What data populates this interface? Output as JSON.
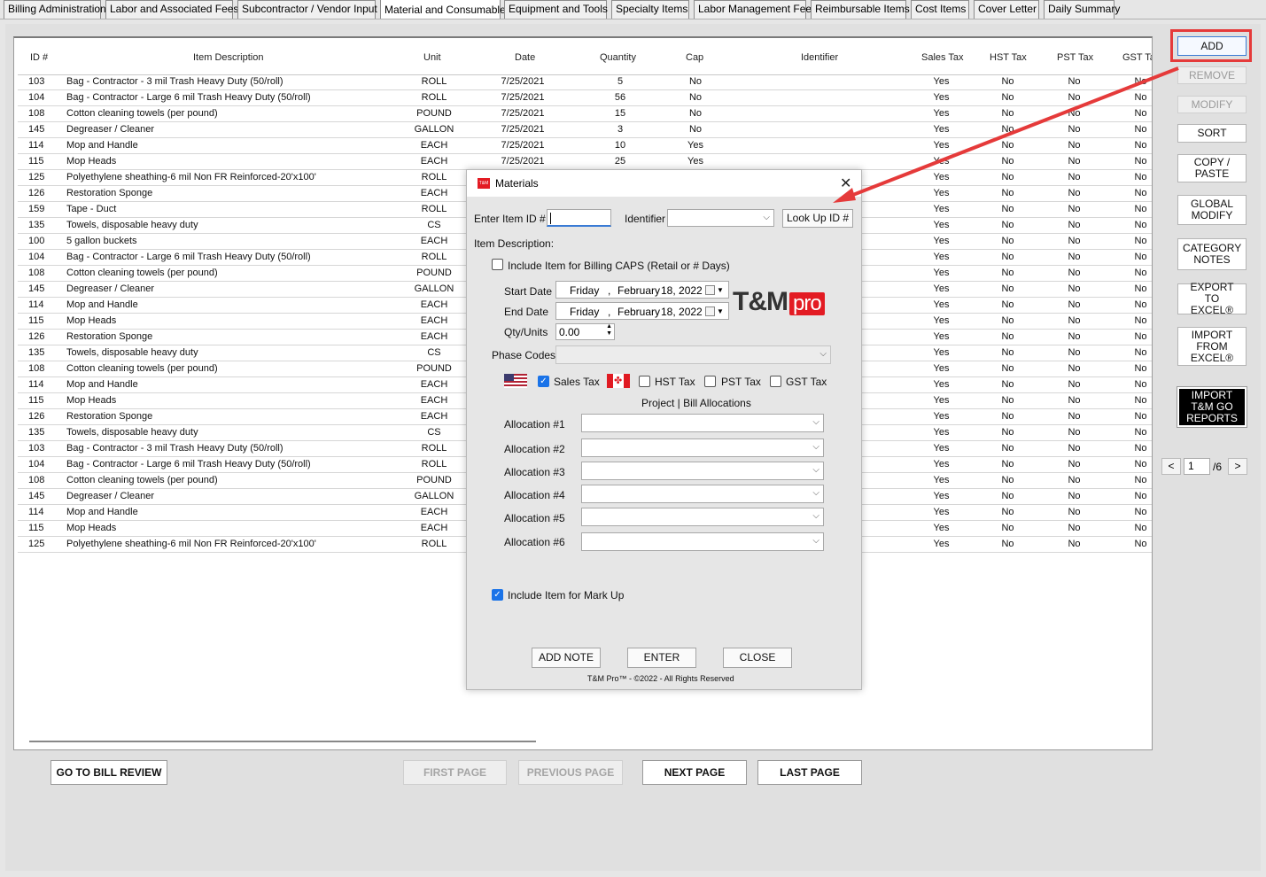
{
  "tabs": [
    "Billing Administration",
    "Labor and Associated Fees",
    "Subcontractor / Vendor Input",
    "Material and Consumable",
    "Equipment and Tools",
    "Specialty Items",
    "Labor Management Fee",
    "Reimbursable Items",
    "Cost Items",
    "Cover Letter",
    "Daily Summary"
  ],
  "active_tab": "Material and Consumable",
  "grid": {
    "headers": {
      "id": "ID #",
      "desc": "Item Description",
      "unit": "Unit",
      "date": "Date",
      "qty": "Quantity",
      "cap": "Cap",
      "identifier": "Identifier",
      "sales_tax": "Sales Tax",
      "hst": "HST Tax",
      "pst": "PST Tax",
      "gst": "GST Ta"
    },
    "rows": [
      {
        "id": "103",
        "desc": "Bag - Contractor - 3 mil Trash Heavy Duty (50/roll)",
        "unit": "ROLL",
        "date": "7/25/2021",
        "qty": "5",
        "cap": "No",
        "stx": "Yes",
        "hst": "No",
        "pst": "No",
        "gst": "No"
      },
      {
        "id": "104",
        "desc": "Bag - Contractor - Large 6 mil Trash Heavy Duty (50/roll)",
        "unit": "ROLL",
        "date": "7/25/2021",
        "qty": "56",
        "cap": "No",
        "stx": "Yes",
        "hst": "No",
        "pst": "No",
        "gst": "No"
      },
      {
        "id": "108",
        "desc": "Cotton cleaning towels (per pound)",
        "unit": "POUND",
        "date": "7/25/2021",
        "qty": "15",
        "cap": "No",
        "stx": "Yes",
        "hst": "No",
        "pst": "No",
        "gst": "No"
      },
      {
        "id": "145",
        "desc": "Degreaser / Cleaner",
        "unit": "GALLON",
        "date": "7/25/2021",
        "qty": "3",
        "cap": "No",
        "stx": "Yes",
        "hst": "No",
        "pst": "No",
        "gst": "No"
      },
      {
        "id": "114",
        "desc": "Mop and Handle",
        "unit": "EACH",
        "date": "7/25/2021",
        "qty": "10",
        "cap": "Yes",
        "stx": "Yes",
        "hst": "No",
        "pst": "No",
        "gst": "No"
      },
      {
        "id": "115",
        "desc": "Mop Heads",
        "unit": "EACH",
        "date": "7/25/2021",
        "qty": "25",
        "cap": "Yes",
        "stx": "Yes",
        "hst": "No",
        "pst": "No",
        "gst": "No"
      },
      {
        "id": "125",
        "desc": "Polyethylene sheathing-6 mil Non FR Reinforced-20'x100'",
        "unit": "ROLL",
        "date": "",
        "qty": "",
        "cap": "",
        "stx": "Yes",
        "hst": "No",
        "pst": "No",
        "gst": "No"
      },
      {
        "id": "126",
        "desc": "Restoration Sponge",
        "unit": "EACH",
        "date": "",
        "qty": "",
        "cap": "",
        "stx": "Yes",
        "hst": "No",
        "pst": "No",
        "gst": "No"
      },
      {
        "id": "159",
        "desc": "Tape - Duct",
        "unit": "ROLL",
        "date": "",
        "qty": "",
        "cap": "",
        "stx": "Yes",
        "hst": "No",
        "pst": "No",
        "gst": "No"
      },
      {
        "id": "135",
        "desc": "Towels, disposable heavy duty",
        "unit": "CS",
        "date": "",
        "qty": "",
        "cap": "",
        "stx": "Yes",
        "hst": "No",
        "pst": "No",
        "gst": "No"
      },
      {
        "id": "100",
        "desc": "5 gallon buckets",
        "unit": "EACH",
        "date": "",
        "qty": "",
        "cap": "",
        "stx": "Yes",
        "hst": "No",
        "pst": "No",
        "gst": "No"
      },
      {
        "id": "104",
        "desc": "Bag - Contractor - Large 6 mil Trash Heavy Duty (50/roll)",
        "unit": "ROLL",
        "date": "",
        "qty": "",
        "cap": "",
        "stx": "Yes",
        "hst": "No",
        "pst": "No",
        "gst": "No"
      },
      {
        "id": "108",
        "desc": "Cotton cleaning towels (per pound)",
        "unit": "POUND",
        "date": "",
        "qty": "",
        "cap": "",
        "stx": "Yes",
        "hst": "No",
        "pst": "No",
        "gst": "No"
      },
      {
        "id": "145",
        "desc": "Degreaser / Cleaner",
        "unit": "GALLON",
        "date": "",
        "qty": "",
        "cap": "",
        "stx": "Yes",
        "hst": "No",
        "pst": "No",
        "gst": "No"
      },
      {
        "id": "114",
        "desc": "Mop and Handle",
        "unit": "EACH",
        "date": "",
        "qty": "",
        "cap": "",
        "stx": "Yes",
        "hst": "No",
        "pst": "No",
        "gst": "No"
      },
      {
        "id": "115",
        "desc": "Mop Heads",
        "unit": "EACH",
        "date": "",
        "qty": "",
        "cap": "",
        "stx": "Yes",
        "hst": "No",
        "pst": "No",
        "gst": "No"
      },
      {
        "id": "126",
        "desc": "Restoration Sponge",
        "unit": "EACH",
        "date": "",
        "qty": "",
        "cap": "",
        "stx": "Yes",
        "hst": "No",
        "pst": "No",
        "gst": "No"
      },
      {
        "id": "135",
        "desc": "Towels, disposable heavy duty",
        "unit": "CS",
        "date": "",
        "qty": "",
        "cap": "",
        "stx": "Yes",
        "hst": "No",
        "pst": "No",
        "gst": "No"
      },
      {
        "id": "108",
        "desc": "Cotton cleaning towels (per pound)",
        "unit": "POUND",
        "date": "",
        "qty": "",
        "cap": "",
        "stx": "Yes",
        "hst": "No",
        "pst": "No",
        "gst": "No"
      },
      {
        "id": "114",
        "desc": "Mop and Handle",
        "unit": "EACH",
        "date": "",
        "qty": "",
        "cap": "",
        "stx": "Yes",
        "hst": "No",
        "pst": "No",
        "gst": "No"
      },
      {
        "id": "115",
        "desc": "Mop Heads",
        "unit": "EACH",
        "date": "",
        "qty": "",
        "cap": "",
        "stx": "Yes",
        "hst": "No",
        "pst": "No",
        "gst": "No"
      },
      {
        "id": "126",
        "desc": "Restoration Sponge",
        "unit": "EACH",
        "date": "",
        "qty": "",
        "cap": "",
        "stx": "Yes",
        "hst": "No",
        "pst": "No",
        "gst": "No"
      },
      {
        "id": "135",
        "desc": "Towels, disposable heavy duty",
        "unit": "CS",
        "date": "",
        "qty": "",
        "cap": "",
        "stx": "Yes",
        "hst": "No",
        "pst": "No",
        "gst": "No"
      },
      {
        "id": "103",
        "desc": "Bag - Contractor - 3 mil Trash Heavy Duty (50/roll)",
        "unit": "ROLL",
        "date": "",
        "qty": "",
        "cap": "",
        "stx": "Yes",
        "hst": "No",
        "pst": "No",
        "gst": "No"
      },
      {
        "id": "104",
        "desc": "Bag - Contractor - Large 6 mil Trash Heavy Duty (50/roll)",
        "unit": "ROLL",
        "date": "",
        "qty": "",
        "cap": "",
        "stx": "Yes",
        "hst": "No",
        "pst": "No",
        "gst": "No"
      },
      {
        "id": "108",
        "desc": "Cotton cleaning towels (per pound)",
        "unit": "POUND",
        "date": "",
        "qty": "",
        "cap": "",
        "stx": "Yes",
        "hst": "No",
        "pst": "No",
        "gst": "No"
      },
      {
        "id": "145",
        "desc": "Degreaser / Cleaner",
        "unit": "GALLON",
        "date": "",
        "qty": "",
        "cap": "",
        "stx": "Yes",
        "hst": "No",
        "pst": "No",
        "gst": "No"
      },
      {
        "id": "114",
        "desc": "Mop and Handle",
        "unit": "EACH",
        "date": "",
        "qty": "",
        "cap": "",
        "stx": "Yes",
        "hst": "No",
        "pst": "No",
        "gst": "No"
      },
      {
        "id": "115",
        "desc": "Mop Heads",
        "unit": "EACH",
        "date": "",
        "qty": "",
        "cap": "",
        "stx": "Yes",
        "hst": "No",
        "pst": "No",
        "gst": "No"
      },
      {
        "id": "125",
        "desc": "Polyethylene sheathing-6 mil Non FR Reinforced-20'x100'",
        "unit": "ROLL",
        "date": "",
        "qty": "",
        "cap": "",
        "stx": "Yes",
        "hst": "No",
        "pst": "No",
        "gst": "No"
      }
    ]
  },
  "right_buttons": {
    "add": "ADD",
    "remove": "REMOVE",
    "modify": "MODIFY",
    "sort": "SORT",
    "copy_paste": "COPY / PASTE",
    "global_modify": "GLOBAL MODIFY",
    "category_notes": "CATEGORY NOTES",
    "export_excel": "EXPORT TO EXCEL®",
    "import_excel": "IMPORT FROM EXCEL®",
    "import_tmgo": "IMPORT T&M GO REPORTS"
  },
  "pagination": {
    "prev": "<",
    "current": "1",
    "total": "/6",
    "next": ">"
  },
  "bottom_buttons": {
    "bill_review": "GO TO BILL REVIEW",
    "first": "FIRST PAGE",
    "previous": "PREVIOUS PAGE",
    "next": "NEXT PAGE",
    "last": "LAST PAGE"
  },
  "dialog": {
    "title": "Materials",
    "icon_text": "T&M",
    "close": "✕",
    "enter_item_label": "Enter Item ID #",
    "identifier_label": "Identifier",
    "lookup_button": "Look Up ID #",
    "item_description_label": "Item Description:",
    "include_caps_label": "Include Item for Billing CAPS (Retail or # Days)",
    "start_date_label": "Start Date",
    "end_date_label": "End Date",
    "start_date": {
      "weekday": "Friday",
      "month": "February",
      "day_year": "18, 2022"
    },
    "end_date": {
      "weekday": "Friday",
      "month": "February",
      "day_year": "18, 2022"
    },
    "qty_label": "Qty/Units",
    "qty_value": "0.00",
    "phase_codes_label": "Phase Codes",
    "sales_tax_label": "Sales Tax",
    "hst_label": "HST Tax",
    "pst_label": "PST Tax",
    "gst_label": "GST Tax",
    "allocations_title": "Project | Bill Allocations",
    "allocations": [
      "Allocation #1",
      "Allocation #2",
      "Allocation #3",
      "Allocation #4",
      "Allocation #5",
      "Allocation #6"
    ],
    "include_markup_label": "Include Item for Mark Up",
    "add_note": "ADD NOTE",
    "enter": "ENTER",
    "close_btn": "CLOSE",
    "footer": "T&M Pro™ - ©2022 - All Rights Reserved",
    "logo_main": "T&M",
    "logo_pro": "pro"
  },
  "colors": {
    "highlight": "#e53a3a",
    "brand_red": "#e31b23",
    "checkbox_blue": "#1a73e8"
  }
}
